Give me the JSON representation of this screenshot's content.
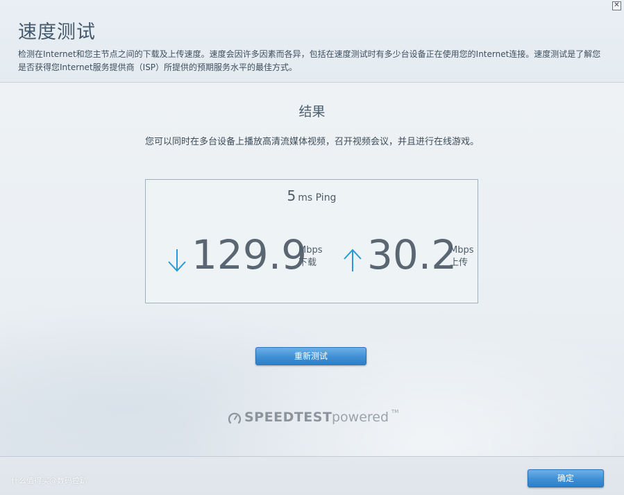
{
  "window": {
    "title": "速度测试",
    "description": "检测在Internet和您主节点之间的下载及上传速度。速度会因许多因素而各异，包括在速度测试时有多少台设备正在使用您的Internet连接。速度测试是了解您是否获得您Internet服务提供商（ISP）所提供的预期服务水平的最佳方式。",
    "close_label": "✕"
  },
  "results": {
    "heading": "结果",
    "message": "您可以同时在多台设备上播放高清流媒体视频，召开视频会议，并且进行在线游戏。",
    "ping": {
      "value": "5",
      "unit": "ms Ping"
    },
    "download": {
      "value": "129.9",
      "unit": "Mbps",
      "label": "下载",
      "icon": "arrow-down-icon"
    },
    "upload": {
      "value": "30.2",
      "unit": "Mbps",
      "label": "上传",
      "icon": "arrow-up-icon"
    }
  },
  "actions": {
    "retest_label": "重新测试",
    "ok_label": "确定"
  },
  "branding": {
    "brand": "SPEEDTEST",
    "powered": "powered",
    "tm": "TM"
  },
  "footer": {
    "watermark": "什么值得买@数码控趴"
  },
  "colors": {
    "accent": "#3f8fd4",
    "arrow": "#2a9ad6",
    "title": "#44596c"
  }
}
